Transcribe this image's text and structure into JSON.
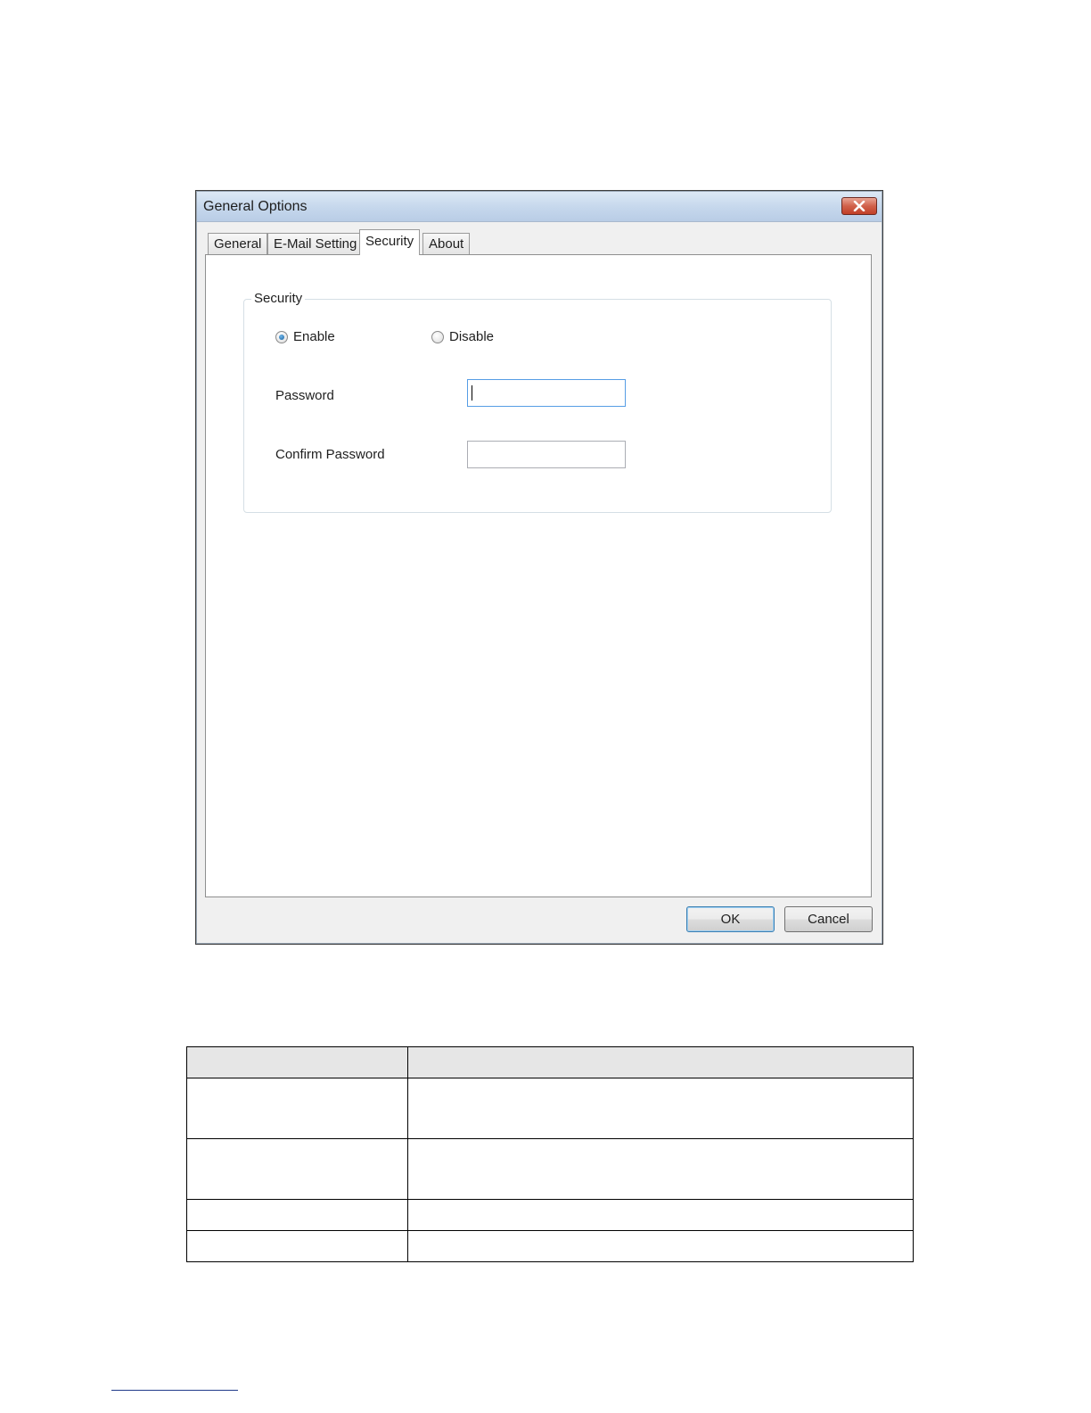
{
  "dialog": {
    "title": "General Options",
    "close_icon": "close-icon",
    "tabs": [
      {
        "label": "General",
        "active": false
      },
      {
        "label": "E-Mail Setting",
        "active": false
      },
      {
        "label": "Security",
        "active": true
      },
      {
        "label": "About",
        "active": false
      }
    ],
    "security_group": {
      "legend": "Security",
      "radio_enable": {
        "label": "Enable",
        "checked": true
      },
      "radio_disable": {
        "label": "Disable",
        "checked": false
      },
      "password": {
        "label": "Password",
        "value": ""
      },
      "confirm_password": {
        "label": "Confirm Password",
        "value": ""
      }
    },
    "buttons": {
      "ok": "OK",
      "cancel": "Cancel"
    }
  },
  "colors": {
    "titlebar": "#c5d7ec",
    "close_button": "#c13f27",
    "dialog_bg": "#f0f0f0",
    "table_header_bg": "#e6e6e6"
  }
}
